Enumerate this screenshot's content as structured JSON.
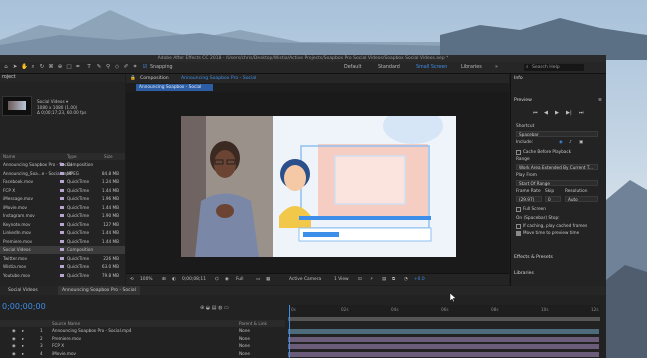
{
  "app": {
    "title": "Adobe After Effects CC 2018 - /Users/chris/Desktop/Wistia/Active Projects/Soapbox Pro Social Videos/Soapbox Social Videos.aep *",
    "snapping_label": "Snapping",
    "workspaces": [
      "Default",
      "Standard",
      "Small Screen",
      "Libraries"
    ],
    "active_workspace": "Small Screen",
    "search_placeholder": "Search Help"
  },
  "project": {
    "panel_label": "roject",
    "selected_name": "Social Videos ▾",
    "selected_info": [
      "1080 x 1080 (1.00)",
      "Δ 0;00;17;23, 60.00 fps"
    ],
    "column_headers": {
      "name": "Name",
      "type": "Type",
      "size": "Size"
    },
    "items": [
      {
        "name": "Announcing Soapbox Pro - Social",
        "type": "Composition",
        "size": "",
        "color": "#b7a6ce"
      },
      {
        "name": "Announcing_Soa...e - Social.mp4",
        "type": "MPEG",
        "size": "84.8 MB",
        "color": "#b7a6ce"
      },
      {
        "name": "Facebook.mov",
        "type": "QuickTime",
        "size": "1.24 MB",
        "color": "#b7a6ce"
      },
      {
        "name": "FCP X",
        "type": "QuickTime",
        "size": "1.44 MB",
        "color": "#b7a6ce"
      },
      {
        "name": "iMessage.mov",
        "type": "QuickTime",
        "size": "1.96 MB",
        "color": "#b7a6ce"
      },
      {
        "name": "iMovie.mov",
        "type": "QuickTime",
        "size": "1.44 MB",
        "color": "#b7a6ce"
      },
      {
        "name": "Instagram.mov",
        "type": "QuickTime",
        "size": "1.90 MB",
        "color": "#b7a6ce"
      },
      {
        "name": "Keynote.mov",
        "type": "QuickTime",
        "size": "127 MB",
        "color": "#b7a6ce"
      },
      {
        "name": "LinkedIn.mov",
        "type": "QuickTime",
        "size": "1.44 MB",
        "color": "#b7a6ce"
      },
      {
        "name": "Premiere.mov",
        "type": "QuickTime",
        "size": "1.44 MB",
        "color": "#b7a6ce"
      },
      {
        "name": "Social Videos",
        "type": "Composition",
        "size": "",
        "color": "#b7a6ce"
      },
      {
        "name": "Twitter.mov",
        "type": "QuickTime",
        "size": "226 MB",
        "color": "#b7a6ce"
      },
      {
        "name": "Wistia.mov",
        "type": "QuickTime",
        "size": "63.0 MB",
        "color": "#b7a6ce"
      },
      {
        "name": "Youtube.mov",
        "type": "QuickTime",
        "size": "79.8 MB",
        "color": "#b7a6ce"
      }
    ],
    "footer": "8 bpc"
  },
  "composition": {
    "header_label": "Composition",
    "comp_name": "Announcing Soapbox Pro - Social",
    "tab_label": "Announcing Soapbox - Social",
    "zoom": "100%",
    "timecode": "0;00;08;11",
    "resolution": "Full",
    "camera": "Active Camera",
    "views": "1 View",
    "exposure": "+0.0"
  },
  "right_panel": {
    "info_label": "Info",
    "preview_label": "Preview",
    "shortcut_label": "Shortcut",
    "shortcut_value": "Spacebar",
    "include_label": "Include:",
    "cache_label": "Cache Before Playback",
    "range_label": "Range",
    "range_value": "Work Area Extended By Current T...",
    "play_from_label": "Play From",
    "play_from_value": "Start Of Range",
    "frame_rate_label": "Frame Rate",
    "skip_label": "Skip",
    "resolution_label": "Resolution",
    "frame_rate_value": "(29.97)",
    "skip_value": "0",
    "resolution_value": "Auto",
    "full_screen_label": "Full Screen",
    "on_stop_label": "On (Spacebar) Stop:",
    "if_caching_label": "If caching, play cached frames",
    "move_time_label": "Move time to preview time",
    "effects_label": "Effects & Presets",
    "libraries_label": "Libraries"
  },
  "timeline": {
    "tabs": [
      "Social Videos",
      "Announcing Soapbox Pro - Social"
    ],
    "timecode": "0;00;00;00",
    "column_headers": {
      "source": "Source Name",
      "parent": "Parent & Link"
    },
    "ruler_ticks": [
      "0s",
      "02s",
      "04s",
      "06s",
      "08s",
      "10s",
      "12s"
    ],
    "layers": [
      {
        "num": "1",
        "name": "Announcing Soapbox Pro - Social.mp4",
        "parent": "None",
        "bar_color": "#4d6b7a"
      },
      {
        "num": "2",
        "name": "Premiere.mov",
        "parent": "None",
        "bar_color": "#6b5d7a"
      },
      {
        "num": "3",
        "name": "FCP X",
        "parent": "None",
        "bar_color": "#6b5d7a"
      },
      {
        "num": "4",
        "name": "iMovie.mov",
        "parent": "None",
        "bar_color": "#6b5d7a"
      }
    ]
  },
  "colors": {
    "accent": "#3d8ee8",
    "panel": "#232323",
    "window": "#1d1d1d"
  }
}
